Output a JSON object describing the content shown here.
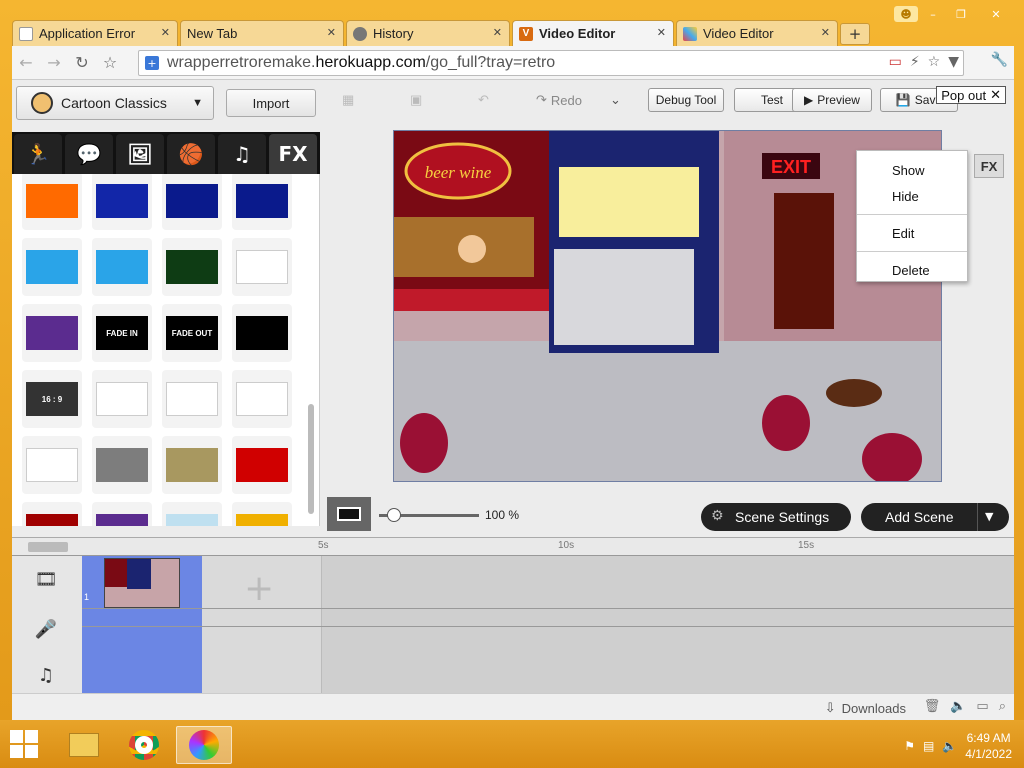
{
  "browser": {
    "tabs": [
      {
        "label": "Application Error",
        "active": false,
        "favicon": "page-icon"
      },
      {
        "label": "New Tab",
        "active": false,
        "favicon": "none"
      },
      {
        "label": "History",
        "active": false,
        "favicon": "clock-icon"
      },
      {
        "label": "Video Editor",
        "active": true,
        "favicon": "video-v-icon"
      },
      {
        "label": "Video Editor",
        "active": false,
        "favicon": "colorful-icon"
      }
    ],
    "url_prefix": "wrapperretroremake.",
    "url_host": "herokuapp.com",
    "url_path": "/go_full?tray=retro"
  },
  "library": {
    "theme_label": "Cartoon Classics",
    "import_label": "Import",
    "category_tabs": [
      "character-icon",
      "speech-bubble-icon",
      "background-icon",
      "prop-ball-icon",
      "music-note-icon",
      "FX"
    ],
    "fx_label": "FX",
    "assets": [
      {
        "name": "fire",
        "bg": "#ff6a00",
        "text": ""
      },
      {
        "name": "lightning",
        "bg": "#1226a8",
        "text": ""
      },
      {
        "name": "stars-night",
        "bg": "#0a1a8c",
        "text": ""
      },
      {
        "name": "rain-drops",
        "bg": "#0a1a8c",
        "text": ""
      },
      {
        "name": "snow-light",
        "bg": "#2aa4e8",
        "text": ""
      },
      {
        "name": "snow-heavy",
        "bg": "#2aa4e8",
        "text": ""
      },
      {
        "name": "green-curtain",
        "bg": "#0e3c14",
        "text": ""
      },
      {
        "name": "hearts",
        "bg": "#ffffff",
        "text": ""
      },
      {
        "name": "purple-frame",
        "bg": "#5b2c8f",
        "text": ""
      },
      {
        "name": "fade-in",
        "bg": "#000000",
        "text": "FADE IN"
      },
      {
        "name": "fade-out",
        "bg": "#000000",
        "text": "FADE OUT"
      },
      {
        "name": "circle-iris",
        "bg": "#000000",
        "text": ""
      },
      {
        "name": "widescreen",
        "bg": "#333333",
        "text": "16 : 9"
      },
      {
        "name": "camera-shake",
        "bg": "#ffffff",
        "text": ""
      },
      {
        "name": "spotlight",
        "bg": "#ffffff",
        "text": ""
      },
      {
        "name": "car-sketch",
        "bg": "#ffffff",
        "text": ""
      },
      {
        "name": "ufo",
        "bg": "#ffffff",
        "text": ""
      },
      {
        "name": "mountains",
        "bg": "#7d7d7d",
        "text": ""
      },
      {
        "name": "desert",
        "bg": "#a89860",
        "text": ""
      },
      {
        "name": "red-frame",
        "bg": "#d00000",
        "text": ""
      },
      {
        "name": "red-curtain",
        "bg": "#a00000",
        "text": ""
      },
      {
        "name": "purple-frame-2",
        "bg": "#5b2c8f",
        "text": ""
      },
      {
        "name": "sky",
        "bg": "#bfe0f0",
        "text": ""
      },
      {
        "name": "sunset",
        "bg": "#f0b000",
        "text": ""
      }
    ]
  },
  "toolbar": {
    "redo_label": "Redo",
    "debug_label": "Debug Tool",
    "test_label": "Test",
    "preview_label": "Preview",
    "save_label": "Save",
    "popout_label": "Pop out"
  },
  "stage": {
    "bar_sign": "beer wine",
    "exit_sign": "EXIT"
  },
  "context_menu": {
    "items": [
      "Show",
      "Hide",
      "Edit",
      "Delete"
    ]
  },
  "stage_footer": {
    "zoom_label": "100 %",
    "zoom_level": 0.15,
    "scene_settings_label": "Scene Settings",
    "add_scene_label": "Add Scene"
  },
  "timeline": {
    "ruler_labels": [
      "5s",
      "10s",
      "15s"
    ],
    "scene_number": "1"
  },
  "statusbar": {
    "downloads_label": "Downloads"
  },
  "taskbar": {
    "time": "6:49 AM",
    "date": "4/1/2022"
  },
  "colors": {
    "accent_orange": "#e8a020",
    "timeline_scene": "#6b86e4"
  }
}
